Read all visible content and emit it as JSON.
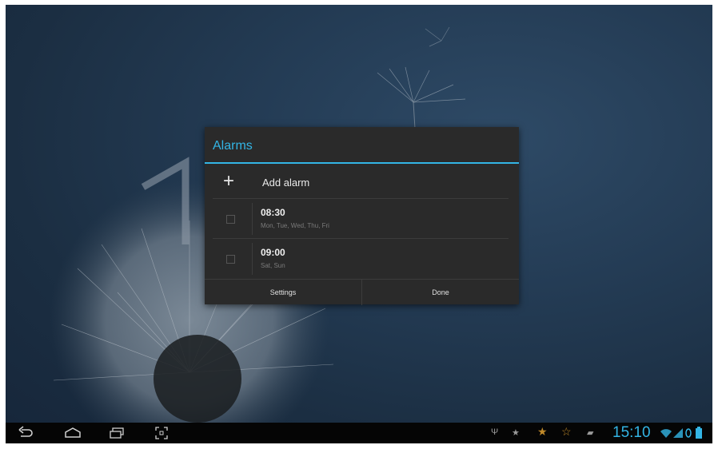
{
  "dialog": {
    "title": "Alarms",
    "add_label": "Add alarm",
    "alarms": [
      {
        "time": "08:30",
        "days": "Mon, Tue, Wed, Thu, Fri",
        "enabled": false
      },
      {
        "time": "09:00",
        "days": "Sat, Sun",
        "enabled": false
      }
    ],
    "settings_label": "Settings",
    "done_label": "Done"
  },
  "status_bar": {
    "time": "15:10",
    "accent": "#33b5e5"
  },
  "icons": {
    "nav": [
      "back-icon",
      "home-icon",
      "recent-apps-icon",
      "screenshot-icon"
    ],
    "status": [
      "usb-icon",
      "star-icon",
      "star-icon",
      "star-icon",
      "chat-icon",
      "wifi-icon",
      "signal-icon",
      "battery-icon"
    ]
  }
}
